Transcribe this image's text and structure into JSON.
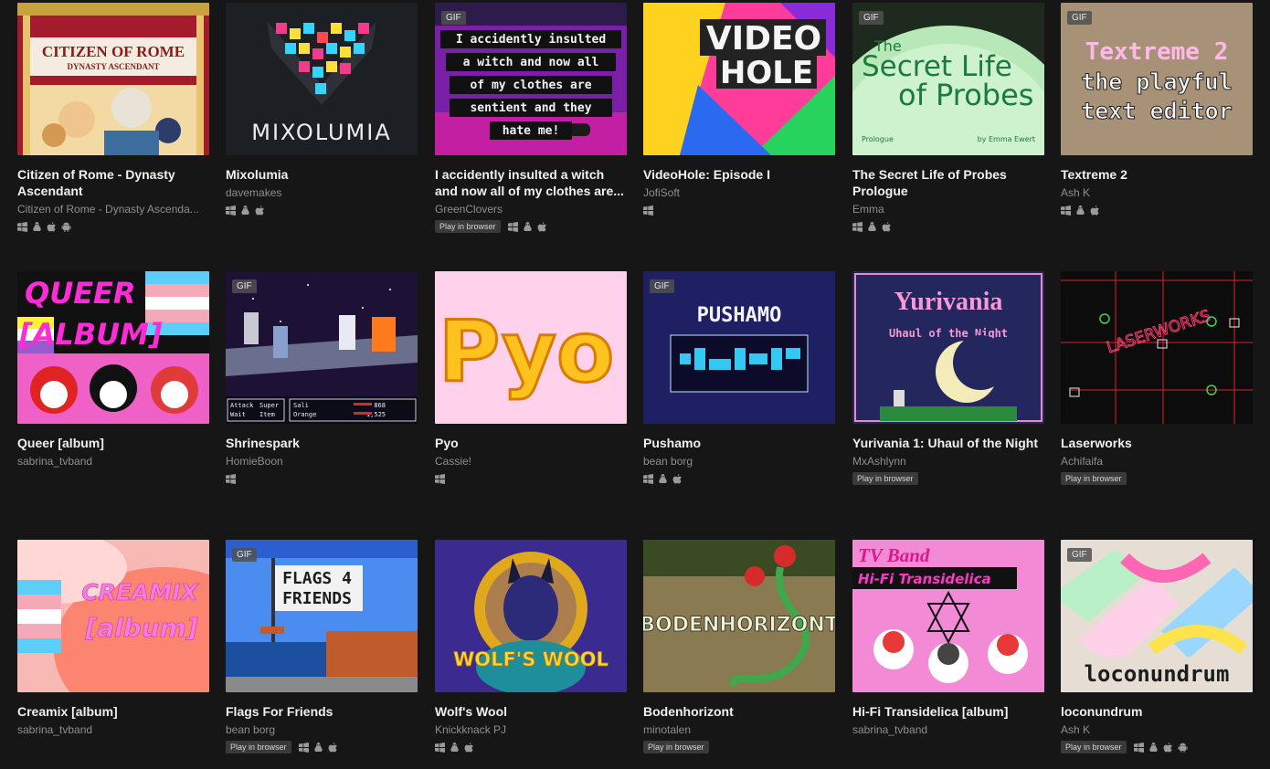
{
  "games": [
    {
      "title": "Citizen of Rome - Dynasty Ascendant",
      "author": "Citizen of Rome - Dynasty Ascenda...",
      "gif": false,
      "browser": false,
      "icons": [
        "windows-icon",
        "linux-icon",
        "apple-icon",
        "android-icon"
      ],
      "cover": {
        "line1": "CITIZEN OF ROME",
        "line2": "DYNASTY ASCENDANT"
      }
    },
    {
      "title": "Mixolumia",
      "author": "davemakes",
      "gif": false,
      "browser": false,
      "icons": [
        "windows-icon",
        "linux-icon",
        "apple-icon"
      ],
      "cover": {
        "line1": "MIXOLUMIA"
      }
    },
    {
      "title": "I accidently insulted a witch and now all of my clothes are...",
      "author": "GreenClovers",
      "gif": true,
      "browser": true,
      "icons": [
        "windows-icon",
        "linux-icon",
        "apple-icon"
      ],
      "cover": {
        "lines": [
          "I accidently insulted",
          "a witch and now all",
          "of my clothes are",
          "sentient and they",
          "hate me!"
        ]
      }
    },
    {
      "title": "VideoHole: Episode I",
      "author": "JofiSoft",
      "gif": false,
      "browser": false,
      "icons": [
        "windows-icon"
      ],
      "cover": {
        "line1": "VIDEO",
        "line2": "HOLE"
      }
    },
    {
      "title": "The Secret Life of Probes Prologue",
      "author": "Emma",
      "gif": true,
      "browser": false,
      "icons": [
        "windows-icon",
        "linux-icon",
        "apple-icon"
      ],
      "cover": {
        "line1": "The",
        "line2": "Secret Life",
        "line3": "of Probes",
        "left": "Prologue",
        "right": "by Emma Ewert"
      }
    },
    {
      "title": "Textreme 2",
      "author": "Ash K",
      "gif": true,
      "browser": false,
      "icons": [
        "windows-icon",
        "linux-icon",
        "apple-icon"
      ],
      "cover": {
        "line1": "Textreme 2",
        "line2": "the playful",
        "line3": "text editor"
      }
    },
    {
      "title": "Queer [album]",
      "author": "sabrina_tvband",
      "gif": false,
      "browser": false,
      "icons": [],
      "cover": {
        "line1": "QUEER",
        "line2": "[ALBUM]"
      }
    },
    {
      "title": "Shrinespark",
      "author": "HomieBoon",
      "gif": true,
      "browser": false,
      "icons": [
        "windows-icon"
      ],
      "cover": {
        "m1": "Attack",
        "m2": "Super",
        "m3": "Wait",
        "m4": "Item",
        "n1": "Sali",
        "n2": "Orange",
        "v1": "868",
        "v2": "1,525"
      }
    },
    {
      "title": "Pyo",
      "author": "Cassie!",
      "gif": false,
      "browser": false,
      "icons": [
        "windows-icon"
      ],
      "cover": {
        "line1": "Pyo"
      }
    },
    {
      "title": "Pushamo",
      "author": "bean borg",
      "gif": true,
      "browser": false,
      "icons": [
        "windows-icon",
        "linux-icon",
        "apple-icon"
      ],
      "cover": {
        "line1": "PUSHAMO"
      }
    },
    {
      "title": "Yurivania 1: Uhaul of the Night",
      "author": "MxAshlynn",
      "gif": false,
      "browser": true,
      "icons": [],
      "cover": {
        "line1": "Yurivania",
        "line2": "Uhaul of the Night"
      }
    },
    {
      "title": "Laserworks",
      "author": "Achifaifa",
      "gif": false,
      "browser": true,
      "icons": [],
      "cover": {
        "line1": "LASERWORKS"
      }
    },
    {
      "title": "Creamix [album]",
      "author": "sabrina_tvband",
      "gif": false,
      "browser": false,
      "icons": [],
      "cover": {
        "line1": "CREAMIX",
        "line2": "[album]"
      }
    },
    {
      "title": "Flags For Friends",
      "author": "bean borg",
      "gif": true,
      "browser": true,
      "icons": [
        "windows-icon",
        "linux-icon",
        "apple-icon"
      ],
      "cover": {
        "line1": "FLAGS 4",
        "line2": "FRIENDS"
      }
    },
    {
      "title": "Wolf's Wool",
      "author": "Knickknack PJ",
      "gif": false,
      "browser": false,
      "icons": [
        "windows-icon",
        "linux-icon",
        "apple-icon"
      ],
      "cover": {
        "line1": "WOLF'S WOOL"
      }
    },
    {
      "title": "Bodenhorizont",
      "author": "minotalen",
      "gif": false,
      "browser": true,
      "icons": [],
      "cover": {
        "line1": "BODENHORIZONT"
      }
    },
    {
      "title": "Hi-Fi Transidelica [album]",
      "author": "sabrina_tvband",
      "gif": false,
      "browser": false,
      "icons": [],
      "cover": {
        "line1": "TV Band",
        "line2": "Hi-Fi Transidelica"
      }
    },
    {
      "title": "loconundrum",
      "author": "Ash K",
      "gif": true,
      "browser": true,
      "icons": [
        "windows-icon",
        "linux-icon",
        "apple-icon",
        "android-icon"
      ],
      "cover": {
        "line1": "loconundrum"
      }
    }
  ],
  "labels": {
    "gif": "GIF",
    "browser": "Play in browser"
  }
}
